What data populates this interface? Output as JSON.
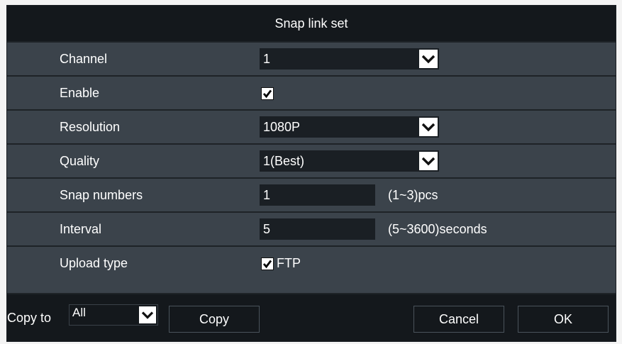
{
  "dialog": {
    "title": "Snap link set"
  },
  "fields": {
    "channel": {
      "label": "Channel",
      "value": "1"
    },
    "enable": {
      "label": "Enable",
      "checked": true
    },
    "resolution": {
      "label": "Resolution",
      "value": "1080P"
    },
    "quality": {
      "label": "Quality",
      "value": "1(Best)"
    },
    "snap_numbers": {
      "label": "Snap numbers",
      "value": "1",
      "hint": "(1~3)pcs"
    },
    "interval": {
      "label": "Interval",
      "value": "5",
      "hint": "(5~3600)seconds"
    },
    "upload_type": {
      "label": "Upload type",
      "option": "FTP",
      "checked": true
    }
  },
  "footer": {
    "copy_to_label": "Copy to",
    "copy_to_value": "All",
    "copy_button": "Copy",
    "cancel_button": "Cancel",
    "ok_button": "OK"
  },
  "colors": {
    "title_bar": "#14181c",
    "panel": "#3b434b",
    "input": "#1a1f24",
    "text": "#ffffff"
  },
  "icons": {
    "dropdown": "chevron-down-icon",
    "check": "checkmark-icon"
  }
}
